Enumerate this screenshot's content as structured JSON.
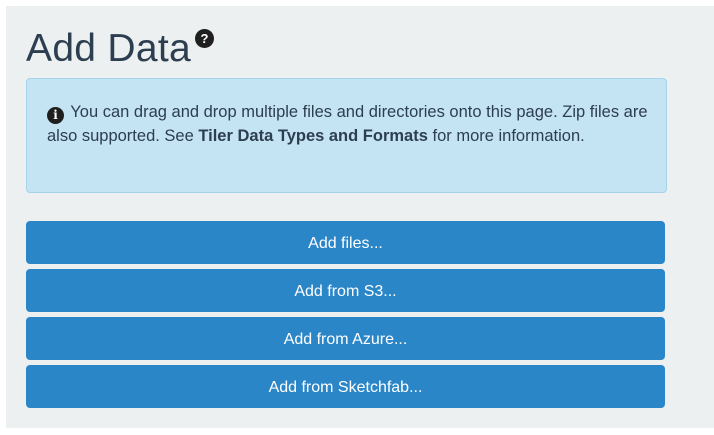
{
  "header": {
    "title": "Add Data",
    "help_icon": "question-circle-icon",
    "help_glyph": "?"
  },
  "info_box": {
    "icon": "info-circle-icon",
    "icon_glyph": "i",
    "text_before": "You can drag and drop multiple files and directories onto this page. Zip files are also supported. See ",
    "link_text": "Tiler Data Types and Formats",
    "text_after": " for more information."
  },
  "buttons": {
    "add_files": "Add files...",
    "add_s3": "Add from S3...",
    "add_azure": "Add from Azure...",
    "add_sketchfab": "Add from Sketchfab..."
  },
  "colors": {
    "panel_bg": "#ecf0f1",
    "info_bg": "#c4e3f3",
    "button_bg": "#2b86c8",
    "title_text": "#2c3e50"
  }
}
